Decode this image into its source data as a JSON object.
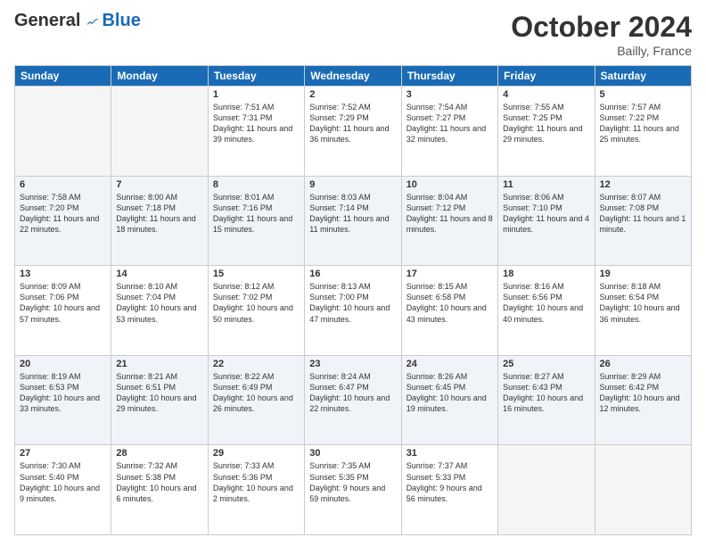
{
  "header": {
    "logo_general": "General",
    "logo_blue": "Blue",
    "month_title": "October 2024",
    "location": "Bailly, France"
  },
  "days_of_week": [
    "Sunday",
    "Monday",
    "Tuesday",
    "Wednesday",
    "Thursday",
    "Friday",
    "Saturday"
  ],
  "weeks": [
    [
      {
        "day": "",
        "empty": true
      },
      {
        "day": "",
        "empty": true
      },
      {
        "day": "1",
        "sunrise": "Sunrise: 7:51 AM",
        "sunset": "Sunset: 7:31 PM",
        "daylight": "Daylight: 11 hours and 39 minutes."
      },
      {
        "day": "2",
        "sunrise": "Sunrise: 7:52 AM",
        "sunset": "Sunset: 7:29 PM",
        "daylight": "Daylight: 11 hours and 36 minutes."
      },
      {
        "day": "3",
        "sunrise": "Sunrise: 7:54 AM",
        "sunset": "Sunset: 7:27 PM",
        "daylight": "Daylight: 11 hours and 32 minutes."
      },
      {
        "day": "4",
        "sunrise": "Sunrise: 7:55 AM",
        "sunset": "Sunset: 7:25 PM",
        "daylight": "Daylight: 11 hours and 29 minutes."
      },
      {
        "day": "5",
        "sunrise": "Sunrise: 7:57 AM",
        "sunset": "Sunset: 7:22 PM",
        "daylight": "Daylight: 11 hours and 25 minutes."
      }
    ],
    [
      {
        "day": "6",
        "sunrise": "Sunrise: 7:58 AM",
        "sunset": "Sunset: 7:20 PM",
        "daylight": "Daylight: 11 hours and 22 minutes."
      },
      {
        "day": "7",
        "sunrise": "Sunrise: 8:00 AM",
        "sunset": "Sunset: 7:18 PM",
        "daylight": "Daylight: 11 hours and 18 minutes."
      },
      {
        "day": "8",
        "sunrise": "Sunrise: 8:01 AM",
        "sunset": "Sunset: 7:16 PM",
        "daylight": "Daylight: 11 hours and 15 minutes."
      },
      {
        "day": "9",
        "sunrise": "Sunrise: 8:03 AM",
        "sunset": "Sunset: 7:14 PM",
        "daylight": "Daylight: 11 hours and 11 minutes."
      },
      {
        "day": "10",
        "sunrise": "Sunrise: 8:04 AM",
        "sunset": "Sunset: 7:12 PM",
        "daylight": "Daylight: 11 hours and 8 minutes."
      },
      {
        "day": "11",
        "sunrise": "Sunrise: 8:06 AM",
        "sunset": "Sunset: 7:10 PM",
        "daylight": "Daylight: 11 hours and 4 minutes."
      },
      {
        "day": "12",
        "sunrise": "Sunrise: 8:07 AM",
        "sunset": "Sunset: 7:08 PM",
        "daylight": "Daylight: 11 hours and 1 minute."
      }
    ],
    [
      {
        "day": "13",
        "sunrise": "Sunrise: 8:09 AM",
        "sunset": "Sunset: 7:06 PM",
        "daylight": "Daylight: 10 hours and 57 minutes."
      },
      {
        "day": "14",
        "sunrise": "Sunrise: 8:10 AM",
        "sunset": "Sunset: 7:04 PM",
        "daylight": "Daylight: 10 hours and 53 minutes."
      },
      {
        "day": "15",
        "sunrise": "Sunrise: 8:12 AM",
        "sunset": "Sunset: 7:02 PM",
        "daylight": "Daylight: 10 hours and 50 minutes."
      },
      {
        "day": "16",
        "sunrise": "Sunrise: 8:13 AM",
        "sunset": "Sunset: 7:00 PM",
        "daylight": "Daylight: 10 hours and 47 minutes."
      },
      {
        "day": "17",
        "sunrise": "Sunrise: 8:15 AM",
        "sunset": "Sunset: 6:58 PM",
        "daylight": "Daylight: 10 hours and 43 minutes."
      },
      {
        "day": "18",
        "sunrise": "Sunrise: 8:16 AM",
        "sunset": "Sunset: 6:56 PM",
        "daylight": "Daylight: 10 hours and 40 minutes."
      },
      {
        "day": "19",
        "sunrise": "Sunrise: 8:18 AM",
        "sunset": "Sunset: 6:54 PM",
        "daylight": "Daylight: 10 hours and 36 minutes."
      }
    ],
    [
      {
        "day": "20",
        "sunrise": "Sunrise: 8:19 AM",
        "sunset": "Sunset: 6:53 PM",
        "daylight": "Daylight: 10 hours and 33 minutes."
      },
      {
        "day": "21",
        "sunrise": "Sunrise: 8:21 AM",
        "sunset": "Sunset: 6:51 PM",
        "daylight": "Daylight: 10 hours and 29 minutes."
      },
      {
        "day": "22",
        "sunrise": "Sunrise: 8:22 AM",
        "sunset": "Sunset: 6:49 PM",
        "daylight": "Daylight: 10 hours and 26 minutes."
      },
      {
        "day": "23",
        "sunrise": "Sunrise: 8:24 AM",
        "sunset": "Sunset: 6:47 PM",
        "daylight": "Daylight: 10 hours and 22 minutes."
      },
      {
        "day": "24",
        "sunrise": "Sunrise: 8:26 AM",
        "sunset": "Sunset: 6:45 PM",
        "daylight": "Daylight: 10 hours and 19 minutes."
      },
      {
        "day": "25",
        "sunrise": "Sunrise: 8:27 AM",
        "sunset": "Sunset: 6:43 PM",
        "daylight": "Daylight: 10 hours and 16 minutes."
      },
      {
        "day": "26",
        "sunrise": "Sunrise: 8:29 AM",
        "sunset": "Sunset: 6:42 PM",
        "daylight": "Daylight: 10 hours and 12 minutes."
      }
    ],
    [
      {
        "day": "27",
        "sunrise": "Sunrise: 7:30 AM",
        "sunset": "Sunset: 5:40 PM",
        "daylight": "Daylight: 10 hours and 9 minutes."
      },
      {
        "day": "28",
        "sunrise": "Sunrise: 7:32 AM",
        "sunset": "Sunset: 5:38 PM",
        "daylight": "Daylight: 10 hours and 6 minutes."
      },
      {
        "day": "29",
        "sunrise": "Sunrise: 7:33 AM",
        "sunset": "Sunset: 5:36 PM",
        "daylight": "Daylight: 10 hours and 2 minutes."
      },
      {
        "day": "30",
        "sunrise": "Sunrise: 7:35 AM",
        "sunset": "Sunset: 5:35 PM",
        "daylight": "Daylight: 9 hours and 59 minutes."
      },
      {
        "day": "31",
        "sunrise": "Sunrise: 7:37 AM",
        "sunset": "Sunset: 5:33 PM",
        "daylight": "Daylight: 9 hours and 56 minutes."
      },
      {
        "day": "",
        "empty": true
      },
      {
        "day": "",
        "empty": true
      }
    ]
  ]
}
